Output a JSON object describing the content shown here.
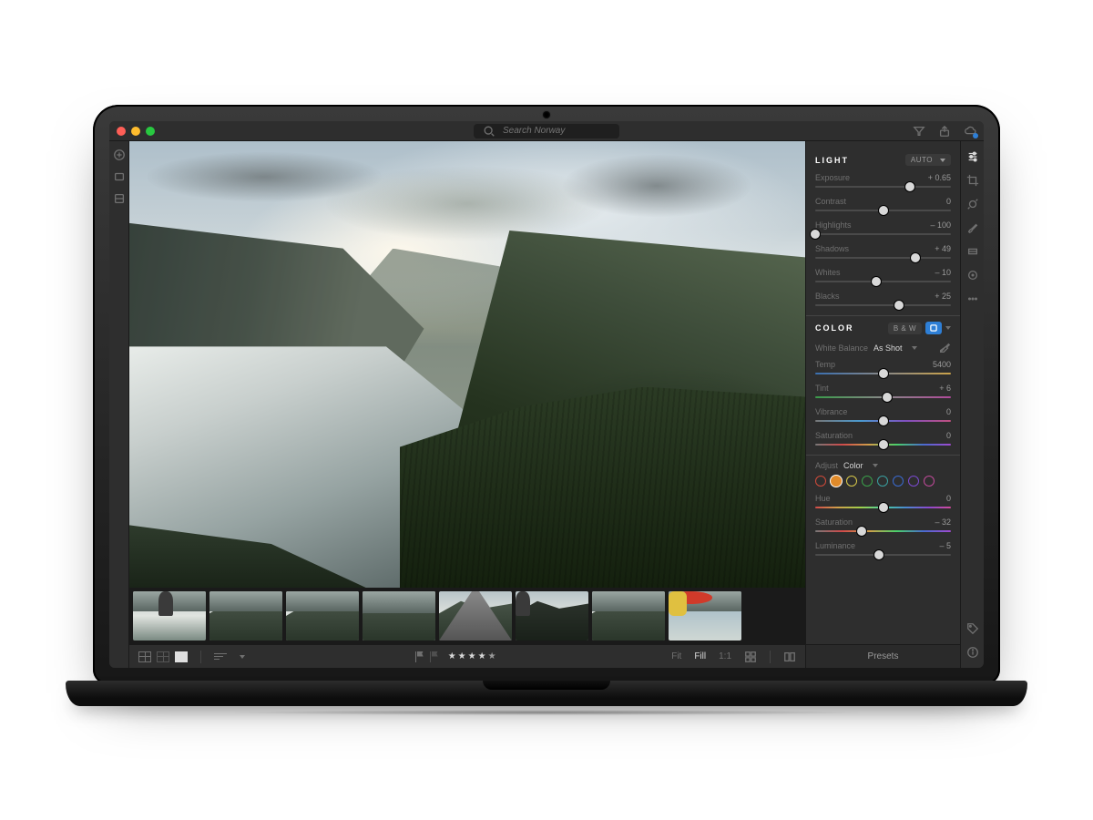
{
  "search": {
    "placeholder": "Search Norway"
  },
  "panels": {
    "light": {
      "title": "LIGHT",
      "auto": "AUTO",
      "sliders": [
        {
          "label": "Exposure",
          "value": "+ 0.65",
          "pos": 70
        },
        {
          "label": "Contrast",
          "value": "0",
          "pos": 50
        },
        {
          "label": "Highlights",
          "value": "– 100",
          "pos": 0
        },
        {
          "label": "Shadows",
          "value": "+ 49",
          "pos": 74
        },
        {
          "label": "Whites",
          "value": "– 10",
          "pos": 45
        },
        {
          "label": "Blacks",
          "value": "+ 25",
          "pos": 62
        }
      ]
    },
    "color": {
      "title": "COLOR",
      "bw": "B & W",
      "wb_label": "White Balance",
      "wb_value": "As Shot",
      "sliders": [
        {
          "label": "Temp",
          "value": "5400",
          "pos": 50,
          "grad": "grad-temp"
        },
        {
          "label": "Tint",
          "value": "+ 6",
          "pos": 53,
          "grad": "grad-tint"
        },
        {
          "label": "Vibrance",
          "value": "0",
          "pos": 50,
          "grad": "grad-vib"
        },
        {
          "label": "Saturation",
          "value": "0",
          "pos": 50,
          "grad": "grad-sat"
        }
      ]
    },
    "mixer": {
      "adjust_label": "Adjust",
      "adjust_value": "Color",
      "swatches": [
        "#d04a3a",
        "#e08a2a",
        "#d8c84a",
        "#3aa04a",
        "#3aa0a0",
        "#3a6ad0",
        "#7a4ad0",
        "#c04a9a"
      ],
      "active_swatch": 1,
      "sliders": [
        {
          "label": "Hue",
          "value": "0",
          "pos": 50,
          "grad": "grad-hue"
        },
        {
          "label": "Saturation",
          "value": "– 32",
          "pos": 34,
          "grad": "grad-sat"
        },
        {
          "label": "Luminance",
          "value": "– 5",
          "pos": 47
        }
      ]
    }
  },
  "presets_label": "Presets",
  "bottombar": {
    "rating": 4,
    "zoom": {
      "options": [
        "Fit",
        "Fill",
        "1:1"
      ],
      "active": "Fill"
    }
  },
  "filmstrip_count": 8,
  "selected_thumb": 3
}
